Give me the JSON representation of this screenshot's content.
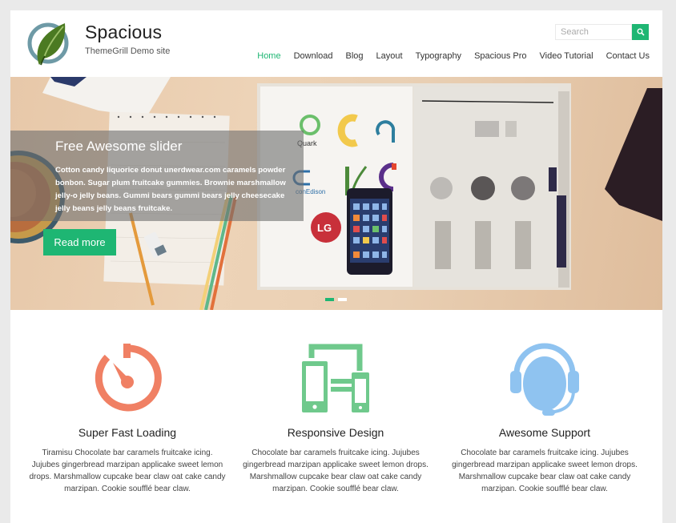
{
  "header": {
    "site_title": "Spacious",
    "site_description": "ThemeGrill Demo site",
    "search_placeholder": "Search",
    "search_icon": "magnifier-icon",
    "nav": [
      {
        "label": "Home",
        "active": true
      },
      {
        "label": "Download",
        "active": false
      },
      {
        "label": "Blog",
        "active": false
      },
      {
        "label": "Layout",
        "active": false
      },
      {
        "label": "Typography",
        "active": false
      },
      {
        "label": "Spacious Pro",
        "active": false
      },
      {
        "label": "Video Tutorial",
        "active": false
      },
      {
        "label": "Contact Us",
        "active": false
      }
    ]
  },
  "slider": {
    "title": "Free Awesome slider",
    "text": "Cotton candy liquorice donut unerdwear.com caramels powder bonbon. Sugar plum fruitcake gummies. Brownie marshmallow jelly-o jelly beans. Gummi bears gummi bears jelly cheesecake jelly beans jelly beans fruitcake.",
    "button_label": "Read more",
    "image_logo_labels": [
      "Quark",
      "conEdison",
      "LG"
    ],
    "slide_count": 2,
    "active_slide": 1
  },
  "services": [
    {
      "icon": "stopwatch-icon",
      "title": "Super Fast Loading",
      "text": "Tiramisu Chocolate bar caramels fruitcake icing. Jujubes gingerbread marzipan applicake sweet lemon drops. Marshmallow cupcake bear claw oat cake candy marzipan. Cookie soufflé bear claw."
    },
    {
      "icon": "responsive-devices-icon",
      "title": "Responsive Design",
      "text": "Chocolate bar caramels fruitcake icing. Jujubes gingerbread marzipan applicake sweet lemon drops. Marshmallow cupcake bear claw oat cake candy marzipan. Cookie soufflé bear claw."
    },
    {
      "icon": "headset-support-icon",
      "title": "Awesome Support",
      "text": "Chocolate bar caramels fruitcake icing. Jujubes gingerbread marzipan applicake sweet lemon drops. Marshmallow cupcake bear claw oat cake candy marzipan. Cookie soufflé bear claw."
    }
  ],
  "colors": {
    "accent": "#1eb673",
    "service_orange": "#f08064",
    "service_green": "#6fc98c",
    "service_blue": "#8fc3f0",
    "page_bg": "#eaeaea"
  }
}
